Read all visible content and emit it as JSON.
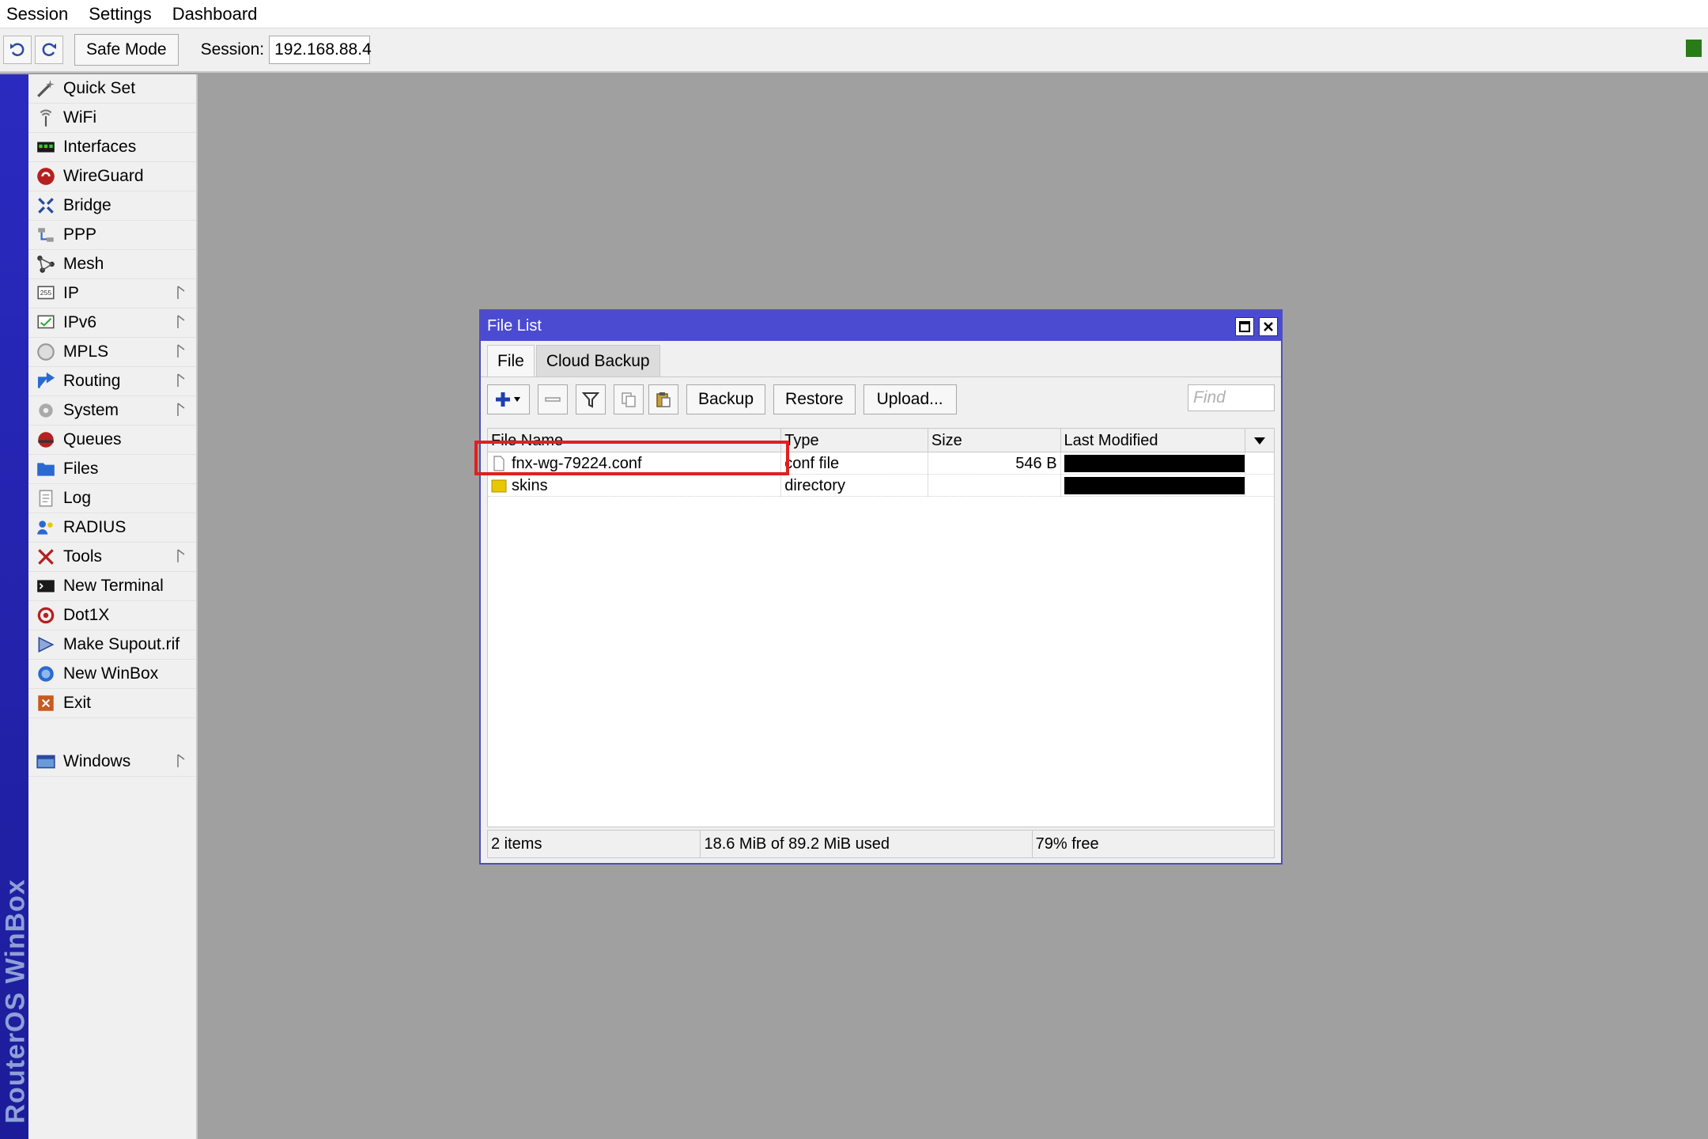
{
  "menu": {
    "items": [
      "Session",
      "Settings",
      "Dashboard"
    ]
  },
  "toolbar": {
    "undo_icon": "undo-icon",
    "redo_icon": "redo-icon",
    "safe_mode_label": "Safe Mode",
    "session_label": "Session:",
    "session_value": "192.168.88.4",
    "status_color": "#2a7a1a"
  },
  "brand": "RouterOS WinBox",
  "sidebar": {
    "items": [
      {
        "label": "Quick Set",
        "icon": "wand-icon",
        "submenu": false
      },
      {
        "label": "WiFi",
        "icon": "antenna-icon",
        "submenu": false
      },
      {
        "label": "Interfaces",
        "icon": "interfaces-icon",
        "submenu": false
      },
      {
        "label": "WireGuard",
        "icon": "wireguard-icon",
        "submenu": false
      },
      {
        "label": "Bridge",
        "icon": "bridge-icon",
        "submenu": false
      },
      {
        "label": "PPP",
        "icon": "ppp-icon",
        "submenu": false
      },
      {
        "label": "Mesh",
        "icon": "mesh-icon",
        "submenu": false
      },
      {
        "label": "IP",
        "icon": "ip-icon",
        "submenu": true
      },
      {
        "label": "IPv6",
        "icon": "ipv6-icon",
        "submenu": true
      },
      {
        "label": "MPLS",
        "icon": "mpls-icon",
        "submenu": true
      },
      {
        "label": "Routing",
        "icon": "routing-icon",
        "submenu": true
      },
      {
        "label": "System",
        "icon": "gear-icon",
        "submenu": true
      },
      {
        "label": "Queues",
        "icon": "queues-icon",
        "submenu": false
      },
      {
        "label": "Files",
        "icon": "folder-icon",
        "submenu": false
      },
      {
        "label": "Log",
        "icon": "log-icon",
        "submenu": false
      },
      {
        "label": "RADIUS",
        "icon": "radius-icon",
        "submenu": false
      },
      {
        "label": "Tools",
        "icon": "tools-icon",
        "submenu": true
      },
      {
        "label": "New Terminal",
        "icon": "terminal-icon",
        "submenu": false
      },
      {
        "label": "Dot1X",
        "icon": "dot1x-icon",
        "submenu": false
      },
      {
        "label": "Make Supout.rif",
        "icon": "supout-icon",
        "submenu": false
      },
      {
        "label": "New WinBox",
        "icon": "winbox-icon",
        "submenu": false
      },
      {
        "label": "Exit",
        "icon": "exit-icon",
        "submenu": false
      }
    ],
    "windows": {
      "label": "Windows",
      "icon": "windows-icon",
      "submenu": true
    }
  },
  "file_window": {
    "title": "File List",
    "tabs": [
      {
        "label": "File",
        "active": true
      },
      {
        "label": "Cloud Backup",
        "active": false
      }
    ],
    "buttons": {
      "backup": "Backup",
      "restore": "Restore",
      "upload": "Upload..."
    },
    "find_placeholder": "Find",
    "columns": [
      "File Name",
      "Type",
      "Size",
      "Last Modified"
    ],
    "rows": [
      {
        "name": "fnx-wg-79224.conf",
        "type": "conf file",
        "size": "546 B",
        "icon": "file-icon"
      },
      {
        "name": "skins",
        "type": "directory",
        "size": "",
        "icon": "folder-icon"
      }
    ],
    "status": {
      "count": "2 items",
      "usage": "18.6 MiB of 89.2 MiB used",
      "free": "79% free"
    }
  }
}
